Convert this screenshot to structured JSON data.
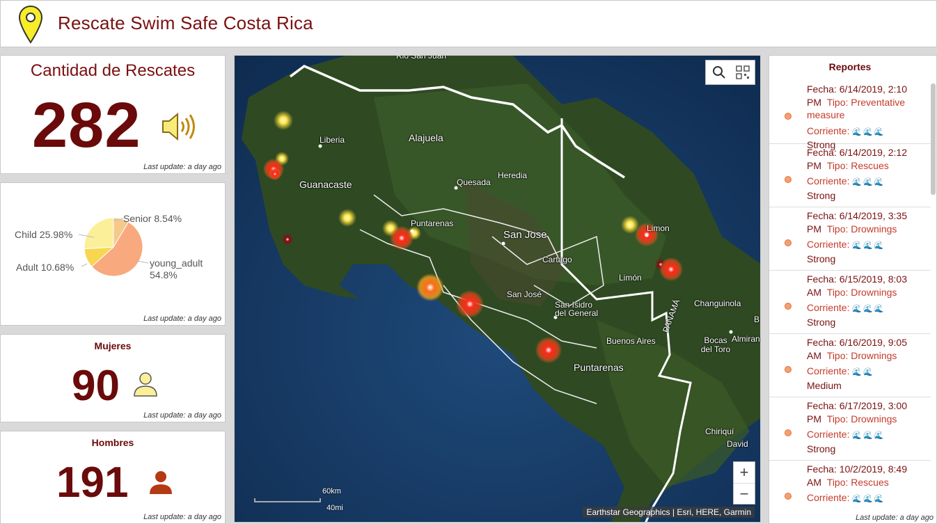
{
  "header": {
    "title": "Rescate Swim Safe Costa Rica"
  },
  "rescates": {
    "title": "Cantidad de Rescates",
    "value": "282",
    "last_update": "Last update: a day ago"
  },
  "pie": {
    "last_update": "Last update: a day ago",
    "chart_data": {
      "type": "pie",
      "slices": [
        {
          "label": "young_adult",
          "value": 54.8,
          "text": "54.8%",
          "color": "#f8a97e"
        },
        {
          "label": "Adult",
          "value": 10.68,
          "text": "Adult 10.68%",
          "color": "#f8d650"
        },
        {
          "label": "Child",
          "value": 25.98,
          "text": "Child 25.98%",
          "color": "#fbef9a"
        },
        {
          "label": "Senior",
          "value": 8.54,
          "text": "Senior 8.54%",
          "color": "#f5c98a"
        }
      ]
    }
  },
  "mujeres": {
    "title": "Mujeres",
    "value": "90",
    "last_update": "Last update: a day ago"
  },
  "hombres": {
    "title": "Hombres",
    "value": "191",
    "last_update": "Last update: a day ago"
  },
  "map": {
    "labels": {
      "rio_san_juan": "Rio San Juan",
      "liberia": "Liberia",
      "alajuela": "Alajuela",
      "guanacaste": "Guanacaste",
      "quesada": "Quesada",
      "heredia": "Heredia",
      "puntarenas_city": "Puntarenas",
      "san_jose_big": "San Jose",
      "cartago": "Cartago",
      "limon_city": "Limon",
      "limon_prov": "Limón",
      "san_jose_small": "San José",
      "san_isidro": "San Isidro del General",
      "changuinola": "Changuinola",
      "panama": "PANAMÁ",
      "bocas": "Bocas del Toro",
      "almirante": "Almiran",
      "buenos_aires": "Buenos Aires",
      "puntarenas_prov": "Puntarenas",
      "chiriqui": "Chiriquí",
      "david": "David",
      "b": "B"
    },
    "scale_km": "60km",
    "scale_mi": "40mi",
    "attribution": "Earthstar Geographics | Esri, HERE, Garmin",
    "zoom_in": "+",
    "zoom_out": "−"
  },
  "reports": {
    "title": "Reportes",
    "last_update": "Last update: a day ago",
    "items": [
      {
        "fecha": "Fecha: 6/14/2019, 2:10 PM",
        "tipo": "Tipo: Preventative measure",
        "corriente": "Corriente:",
        "waves": "🌊🌊🌊",
        "strength": "Strong"
      },
      {
        "fecha": "Fecha: 6/14/2019, 2:12 PM",
        "tipo": "Tipo: Rescues",
        "corriente": "Corriente:",
        "waves": "🌊🌊🌊",
        "strength": "Strong"
      },
      {
        "fecha": "Fecha: 6/14/2019, 3:35 PM",
        "tipo": "Tipo: Drownings",
        "corriente": "Corriente:",
        "waves": "🌊🌊🌊",
        "strength": "Strong"
      },
      {
        "fecha": "Fecha: 6/15/2019, 8:03 AM",
        "tipo": "Tipo: Drownings",
        "corriente": "Corriente:",
        "waves": "🌊🌊🌊",
        "strength": "Strong"
      },
      {
        "fecha": "Fecha: 6/16/2019, 9:05 AM",
        "tipo": "Tipo: Drownings",
        "corriente": "Corriente:",
        "waves": "🌊🌊",
        "strength": "Medium"
      },
      {
        "fecha": "Fecha: 6/17/2019, 3:00 PM",
        "tipo": "Tipo: Drownings",
        "corriente": "Corriente:",
        "waves": "🌊🌊🌊",
        "strength": "Strong"
      },
      {
        "fecha": "Fecha: 10/2/2019, 8:49 AM",
        "tipo": "Tipo: Rescues",
        "corriente": "Corriente:",
        "waves": "🌊🌊🌊",
        "strength": ""
      }
    ]
  }
}
